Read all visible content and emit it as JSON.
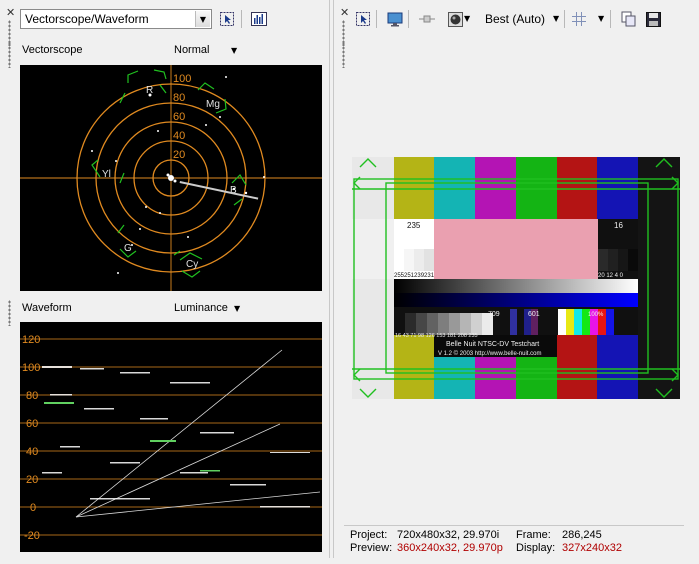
{
  "left": {
    "scope_selector": "Vectorscope/Waveform",
    "vectorscope": {
      "label": "Vectorscope",
      "mode": "Normal",
      "ring_labels": [
        "100",
        "80",
        "60",
        "40",
        "20"
      ],
      "target_labels": [
        "R",
        "Mg",
        "B",
        "Cy",
        "G",
        "Yl"
      ]
    },
    "waveform": {
      "label": "Waveform",
      "mode": "Luminance",
      "scale_labels": [
        "120",
        "100",
        "80",
        "60",
        "40",
        "20",
        "0",
        "-20"
      ]
    }
  },
  "right": {
    "toolbar": {
      "quality": "Best (Auto)"
    },
    "testchart": {
      "top_values": [
        "235",
        "16"
      ],
      "left_values": "255251239231",
      "right_values": "20 12  4  0",
      "mid_values": [
        "709",
        "601",
        "100%"
      ],
      "bottom_values": "16 43 71 98 126 153 181 208 235",
      "title": "Belle Nuit NTSC-DV Testchart",
      "subtitle": "V 1.2 © 2003 http://www.belle-nuit.com"
    },
    "status": {
      "project_label": "Project:",
      "project_value": "720x480x32, 29.970i",
      "frame_label": "Frame:",
      "frame_value": "286,245",
      "preview_label": "Preview:",
      "preview_value": "360x240x32, 29.970p",
      "display_label": "Display:",
      "display_value": "327x240x32"
    }
  },
  "colors": {
    "scope_orange": "#e08a20",
    "target_green": "#20c020",
    "status_red": "#b00000"
  }
}
